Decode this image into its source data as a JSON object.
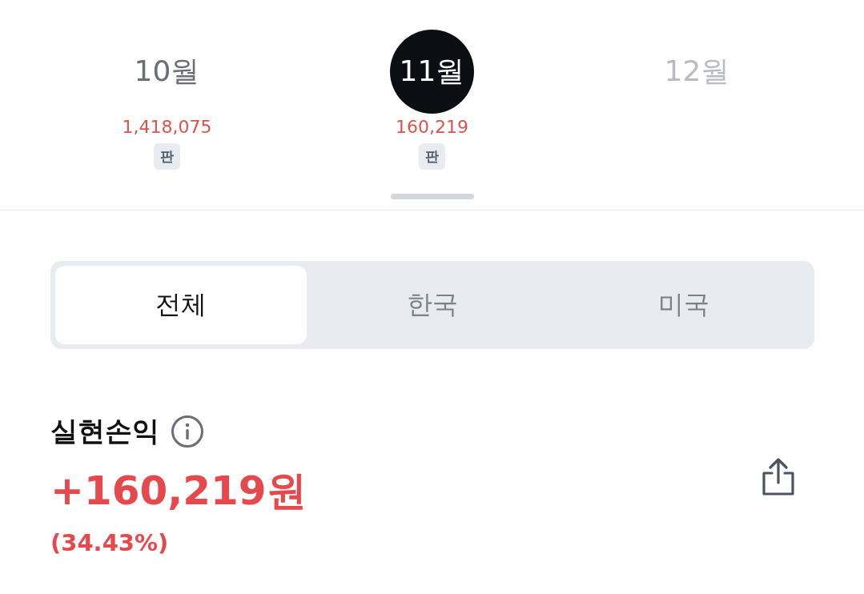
{
  "months": [
    {
      "label": "10월",
      "selected": false,
      "disabled": false,
      "amount": "1,418,075",
      "badge": "판"
    },
    {
      "label": "11월",
      "selected": true,
      "disabled": false,
      "amount": "160,219",
      "badge": "판"
    },
    {
      "label": "12월",
      "selected": false,
      "disabled": true
    }
  ],
  "segments": [
    {
      "label": "전체",
      "selected": true
    },
    {
      "label": "한국",
      "selected": false
    },
    {
      "label": "미국",
      "selected": false
    }
  ],
  "summary": {
    "title": "실현손익",
    "amount": "+160,219원",
    "rate": "(34.43%)"
  }
}
